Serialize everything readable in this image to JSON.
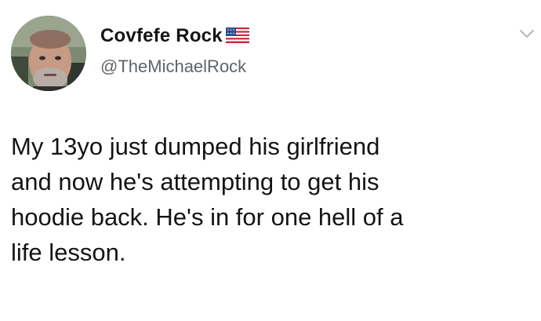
{
  "tweet": {
    "author": {
      "display_name": "Covfefe Rock",
      "flag_icon": "us-flag-icon",
      "handle": "@TheMichaelRock",
      "avatar": "profile-photo"
    },
    "menu_icon": "chevron-down-icon",
    "text_lines": [
      "My 13yo just dumped his girlfriend",
      "and now he's attempting to get his",
      "hoodie back. He's in for one hell of a",
      "life lesson."
    ]
  },
  "colors": {
    "background": "#ffffff",
    "text": "#141414",
    "handle": "#5f6468",
    "chevron": "#b5b8bb"
  }
}
